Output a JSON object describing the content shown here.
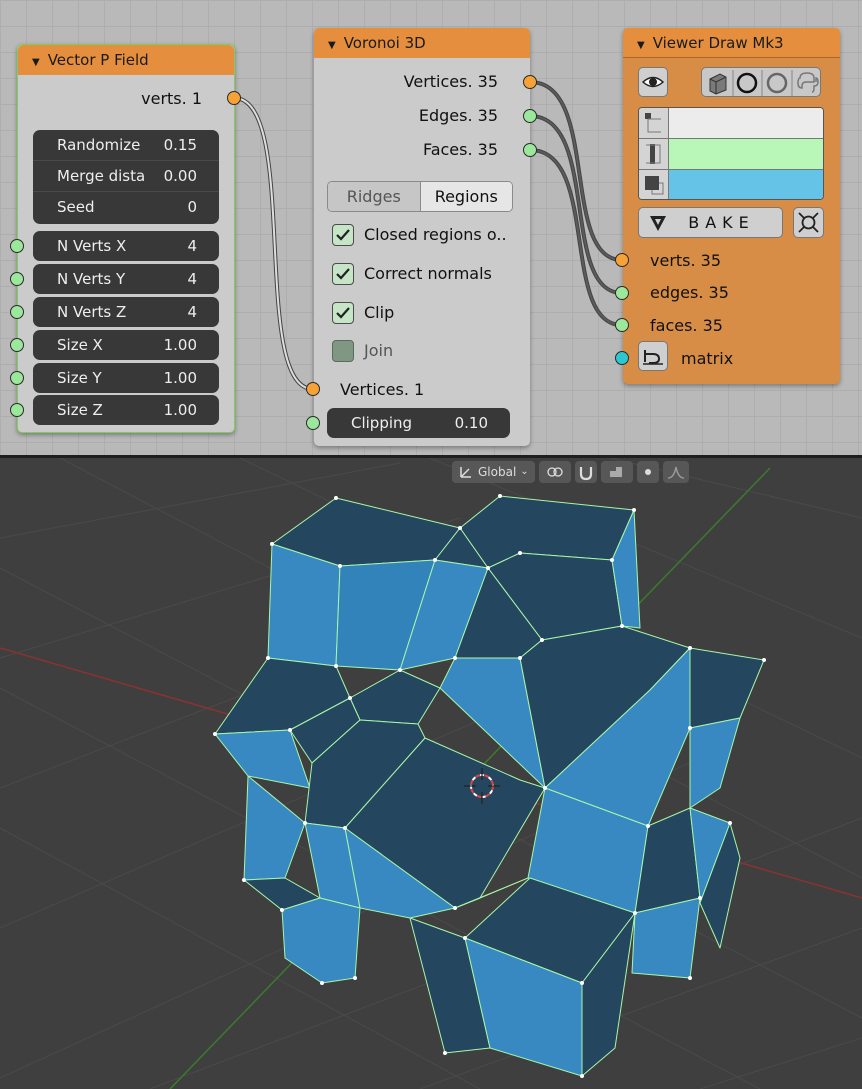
{
  "vector_field": {
    "title": "Vector P Field",
    "output_label": "verts. 1",
    "group": [
      {
        "label": "Randomize",
        "value": "0.15"
      },
      {
        "label": "Merge dista",
        "value": "0.00"
      },
      {
        "label": "Seed",
        "value": "0"
      }
    ],
    "inputs": [
      {
        "label": "N Verts X",
        "value": "4"
      },
      {
        "label": "N Verts Y",
        "value": "4"
      },
      {
        "label": "N Verts Z",
        "value": "4"
      },
      {
        "label": "Size X",
        "value": "1.00"
      },
      {
        "label": "Size Y",
        "value": "1.00"
      },
      {
        "label": "Size Z",
        "value": "1.00"
      }
    ]
  },
  "voronoi": {
    "title": "Voronoi 3D",
    "outputs": [
      "Vertices. 35",
      "Edges. 35",
      "Faces. 35"
    ],
    "tabs": [
      "Ridges",
      "Regions"
    ],
    "active_tab": "Regions",
    "checks": [
      {
        "label": "Closed regions o..",
        "checked": true
      },
      {
        "label": "Correct normals",
        "checked": true
      },
      {
        "label": "Clip",
        "checked": true
      },
      {
        "label": "Join",
        "checked": false
      }
    ],
    "input_vertices": "Vertices. 1",
    "clipping_label": "Clipping",
    "clipping_value": "0.10"
  },
  "viewer": {
    "title": "Viewer Draw Mk3",
    "bake_label": "BAKE",
    "inputs": [
      "verts. 35",
      "edges. 35",
      "faces. 35",
      "matrix"
    ],
    "colors": {
      "verts": "#ececec",
      "edges": "#b8f7b8",
      "faces": "#66c3e8"
    }
  },
  "viewport_header": {
    "orientation": "Global"
  },
  "colors": {
    "node_header": "#e58f3e",
    "socket_vertex": "#f6a237",
    "socket_number": "#9be79b",
    "socket_matrix": "#2cc7d1",
    "mesh_light": "#3889c2",
    "mesh_dark": "#25465f",
    "mesh_edge": "#a8f7a8"
  }
}
